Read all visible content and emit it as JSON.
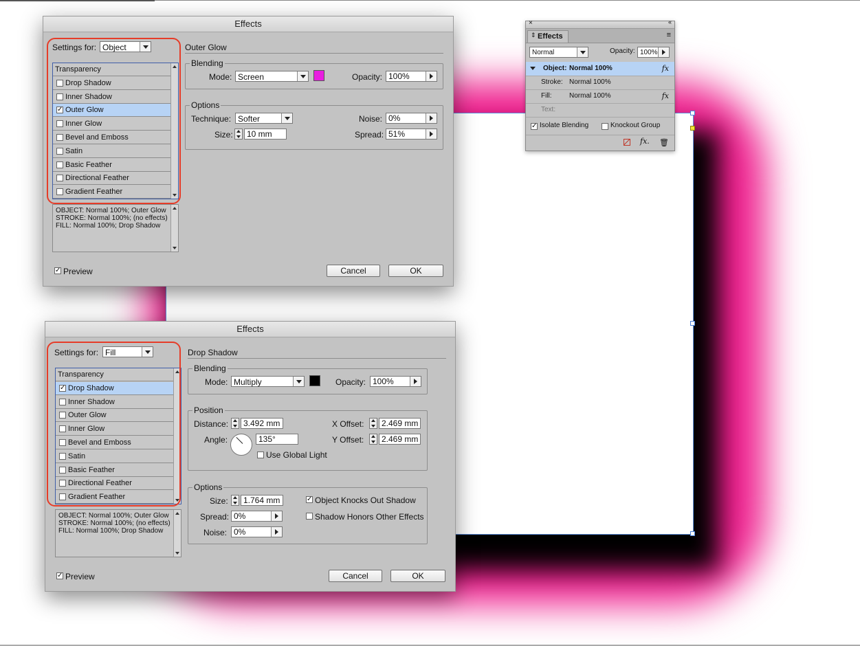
{
  "dialog_top": {
    "title": "Effects",
    "settings_for_label": "Settings for:",
    "settings_for_value": "Object",
    "section_title": "Outer Glow",
    "effects_list": [
      {
        "label": "Transparency",
        "header": true
      },
      {
        "label": "Drop Shadow",
        "checked": false
      },
      {
        "label": "Inner Shadow",
        "checked": false
      },
      {
        "label": "Outer Glow",
        "checked": true,
        "selected": true
      },
      {
        "label": "Inner Glow",
        "checked": false
      },
      {
        "label": "Bevel and Emboss",
        "checked": false
      },
      {
        "label": "Satin",
        "checked": false
      },
      {
        "label": "Basic Feather",
        "checked": false
      },
      {
        "label": "Directional Feather",
        "checked": false
      },
      {
        "label": "Gradient Feather",
        "checked": false
      }
    ],
    "summary": [
      "OBJECT: Normal 100%; Outer Glow",
      "STROKE: Normal 100%; (no effects)",
      "FILL: Normal 100%; Drop Shadow"
    ],
    "blending": {
      "title": "Blending",
      "mode_label": "Mode:",
      "mode_value": "Screen",
      "swatch_color": "#e91ee0",
      "opacity_label": "Opacity:",
      "opacity_value": "100%"
    },
    "options": {
      "title": "Options",
      "technique_label": "Technique:",
      "technique_value": "Softer",
      "noise_label": "Noise:",
      "noise_value": "0%",
      "size_label": "Size:",
      "size_value": "10 mm",
      "spread_label": "Spread:",
      "spread_value": "51%"
    },
    "preview_label": "Preview",
    "preview_checked": true,
    "cancel_label": "Cancel",
    "ok_label": "OK"
  },
  "dialog_bottom": {
    "title": "Effects",
    "settings_for_label": "Settings for:",
    "settings_for_value": "Fill",
    "section_title": "Drop Shadow",
    "effects_list": [
      {
        "label": "Transparency",
        "header": true
      },
      {
        "label": "Drop Shadow",
        "checked": true,
        "selected": true
      },
      {
        "label": "Inner Shadow",
        "checked": false
      },
      {
        "label": "Outer Glow",
        "checked": false
      },
      {
        "label": "Inner Glow",
        "checked": false
      },
      {
        "label": "Bevel and Emboss",
        "checked": false
      },
      {
        "label": "Satin",
        "checked": false
      },
      {
        "label": "Basic Feather",
        "checked": false
      },
      {
        "label": "Directional Feather",
        "checked": false
      },
      {
        "label": "Gradient Feather",
        "checked": false
      }
    ],
    "summary": [
      "OBJECT: Normal 100%; Outer Glow",
      "STROKE: Normal 100%; (no effects)",
      "FILL: Normal 100%; Drop Shadow"
    ],
    "blending": {
      "title": "Blending",
      "mode_label": "Mode:",
      "mode_value": "Multiply",
      "swatch_color": "#000000",
      "opacity_label": "Opacity:",
      "opacity_value": "100%"
    },
    "position": {
      "title": "Position",
      "distance_label": "Distance:",
      "distance_value": "3.492 mm",
      "angle_label": "Angle:",
      "angle_value": "135°",
      "use_global_light_label": "Use Global Light",
      "use_global_light_checked": false,
      "x_offset_label": "X Offset:",
      "x_offset_value": "2.469 mm",
      "y_offset_label": "Y Offset:",
      "y_offset_value": "2.469 mm"
    },
    "options": {
      "title": "Options",
      "size_label": "Size:",
      "size_value": "1.764 mm",
      "spread_label": "Spread:",
      "spread_value": "0%",
      "noise_label": "Noise:",
      "noise_value": "0%",
      "knocks_out_label": "Object Knocks Out Shadow",
      "knocks_out_checked": true,
      "honors_label": "Shadow Honors Other Effects",
      "honors_checked": false
    },
    "preview_label": "Preview",
    "preview_checked": true,
    "cancel_label": "Cancel",
    "ok_label": "OK"
  },
  "effects_panel": {
    "tab_label": "Effects",
    "blend_mode": "Normal",
    "opacity_label": "Opacity:",
    "opacity_value": "100%",
    "rows": [
      {
        "label": "Object:",
        "value": "Normal 100%",
        "fx": true,
        "selected": true
      },
      {
        "label": "Stroke:",
        "value": "Normal 100%",
        "fx": false
      },
      {
        "label": "Fill:",
        "value": "Normal 100%",
        "fx": true
      },
      {
        "label": "Text:",
        "value": "",
        "fx": false
      }
    ],
    "fx_symbol": "fx",
    "fx_menu_symbol": "fx.",
    "isolate_label": "Isolate Blending",
    "isolate_checked": true,
    "knockout_label": "Knockout Group",
    "knockout_checked": false
  },
  "colors": {
    "glow": "#ee1c8c",
    "selection": "#b7d3f5",
    "highlight_box": "#e63c28"
  }
}
